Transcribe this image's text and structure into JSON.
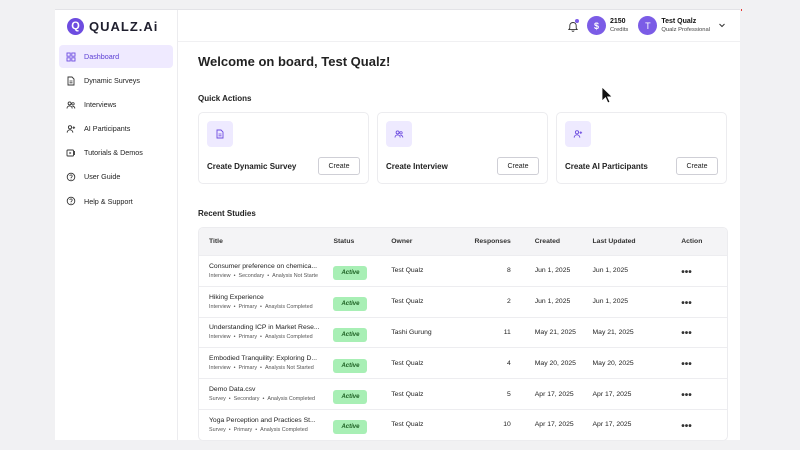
{
  "logo": {
    "mark": "Q",
    "text": "QUALZ.Ai"
  },
  "sidebar": {
    "items": [
      {
        "label": "Dashboard",
        "icon": "dashboard-icon",
        "active": true
      },
      {
        "label": "Dynamic Surveys",
        "icon": "document-icon"
      },
      {
        "label": "Interviews",
        "icon": "users-icon"
      },
      {
        "label": "AI Participants",
        "icon": "user-plus-icon"
      },
      {
        "label": "Tutorials & Demos",
        "icon": "video-icon"
      },
      {
        "label": "User Guide",
        "icon": "help-circle-icon"
      },
      {
        "label": "Help & Support",
        "icon": "help-circle-icon"
      }
    ]
  },
  "header": {
    "credits_value": "2150",
    "credits_label": "Credits",
    "credits_symbol": "$",
    "avatar_initial": "T",
    "user_name": "Test Qualz",
    "user_role": "Qualz Professional"
  },
  "welcome": "Welcome on board, Test Qualz!",
  "quick_actions": {
    "title": "Quick Actions",
    "cards": [
      {
        "label": "Create Dynamic Survey",
        "button": "Create",
        "icon": "document-icon"
      },
      {
        "label": "Create Interview",
        "button": "Create",
        "icon": "users-icon"
      },
      {
        "label": "Create AI Participants",
        "button": "Create",
        "icon": "user-plus-icon"
      }
    ]
  },
  "recent_studies": {
    "title": "Recent Studies",
    "columns": {
      "title": "Title",
      "status": "Status",
      "owner": "Owner",
      "responses": "Responses",
      "created": "Created",
      "updated": "Last Updated",
      "action": "Action"
    },
    "rows": [
      {
        "name": "Consumer preference on chemica...",
        "type": "Interview",
        "audience": "Secondary",
        "analysis": "Analysis Not Starte",
        "status": "Active",
        "owner": "Test Qualz",
        "responses": "8",
        "created": "Jun 1, 2025",
        "updated": "Jun 1, 2025",
        "action": "•••"
      },
      {
        "name": "Hiking Experience",
        "type": "Interview",
        "audience": "Primary",
        "analysis": "Anaylsis Completed",
        "status": "Active",
        "owner": "Test Qualz",
        "responses": "2",
        "created": "Jun 1, 2025",
        "updated": "Jun 1, 2025",
        "action": "•••"
      },
      {
        "name": "Understanding ICP in Market Rese...",
        "type": "Interview",
        "audience": "Primary",
        "analysis": "Analysis Completed",
        "status": "Active",
        "owner": "Tashi Gurung",
        "responses": "11",
        "created": "May 21, 2025",
        "updated": "May 21, 2025",
        "action": "•••"
      },
      {
        "name": "Embodied Tranquility: Exploring D...",
        "type": "Interview",
        "audience": "Primary",
        "analysis": "Analysis Not Started",
        "status": "Active",
        "owner": "Test Qualz",
        "responses": "4",
        "created": "May 20, 2025",
        "updated": "May 20, 2025",
        "action": "•••"
      },
      {
        "name": "Demo Data.csv",
        "type": "Survey",
        "audience": "Secondary",
        "analysis": "Analysis Completed",
        "status": "Active",
        "owner": "Test Qualz",
        "responses": "5",
        "created": "Apr 17, 2025",
        "updated": "Apr 17, 2025",
        "action": "•••"
      },
      {
        "name": "Yoga Perception and Practices St...",
        "type": "Survey",
        "audience": "Primary",
        "analysis": "Analysis Completed",
        "status": "Active",
        "owner": "Test Qualz",
        "responses": "10",
        "created": "Apr 17, 2025",
        "updated": "Apr 17, 2025",
        "action": "•••"
      }
    ]
  },
  "colors": {
    "accent": "#6d4ce0",
    "active_bg": "#efeaff",
    "badge_bg": "#a8efb5",
    "badge_text": "#1b5e20"
  }
}
